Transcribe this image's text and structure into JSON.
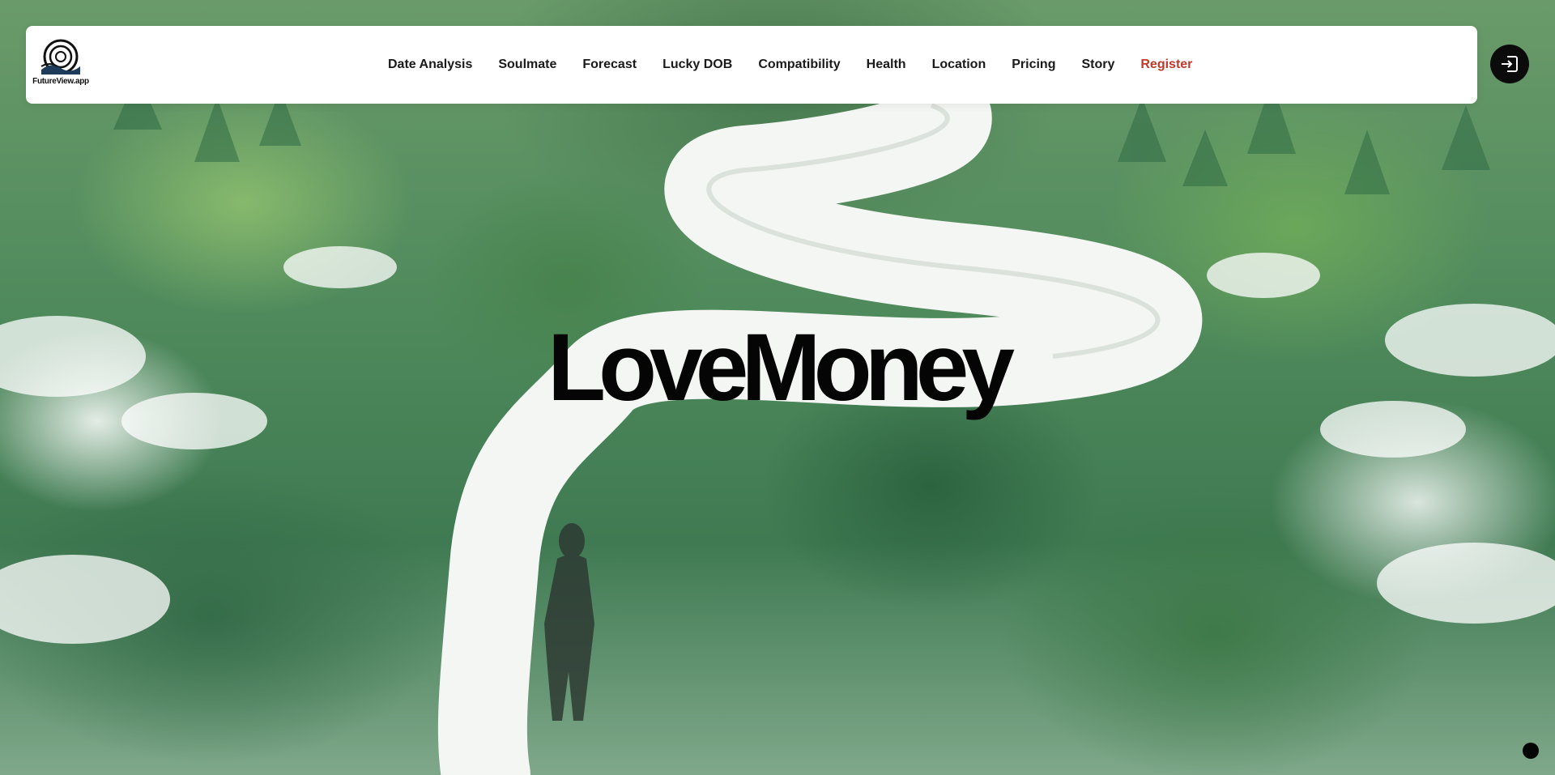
{
  "brand": {
    "name": "FutureView.app",
    "logo_icon": "spiral-landscape-logo-icon"
  },
  "nav": {
    "items": [
      {
        "label": "Date Analysis"
      },
      {
        "label": "Soulmate"
      },
      {
        "label": "Forecast"
      },
      {
        "label": "Lucky DOB"
      },
      {
        "label": "Compatibility"
      },
      {
        "label": "Health"
      },
      {
        "label": "Location"
      },
      {
        "label": "Pricing"
      },
      {
        "label": "Story"
      }
    ],
    "register_label": "Register",
    "register_color": "#c0392b",
    "login_icon": "login-icon"
  },
  "hero": {
    "title": "LoveMoney",
    "background": "illustration of a winding white path through a green forest with a person walking"
  },
  "colors": {
    "nav_bg": "#ffffff",
    "text": "#1a1a1a",
    "button_bg": "#0b0b0b"
  }
}
